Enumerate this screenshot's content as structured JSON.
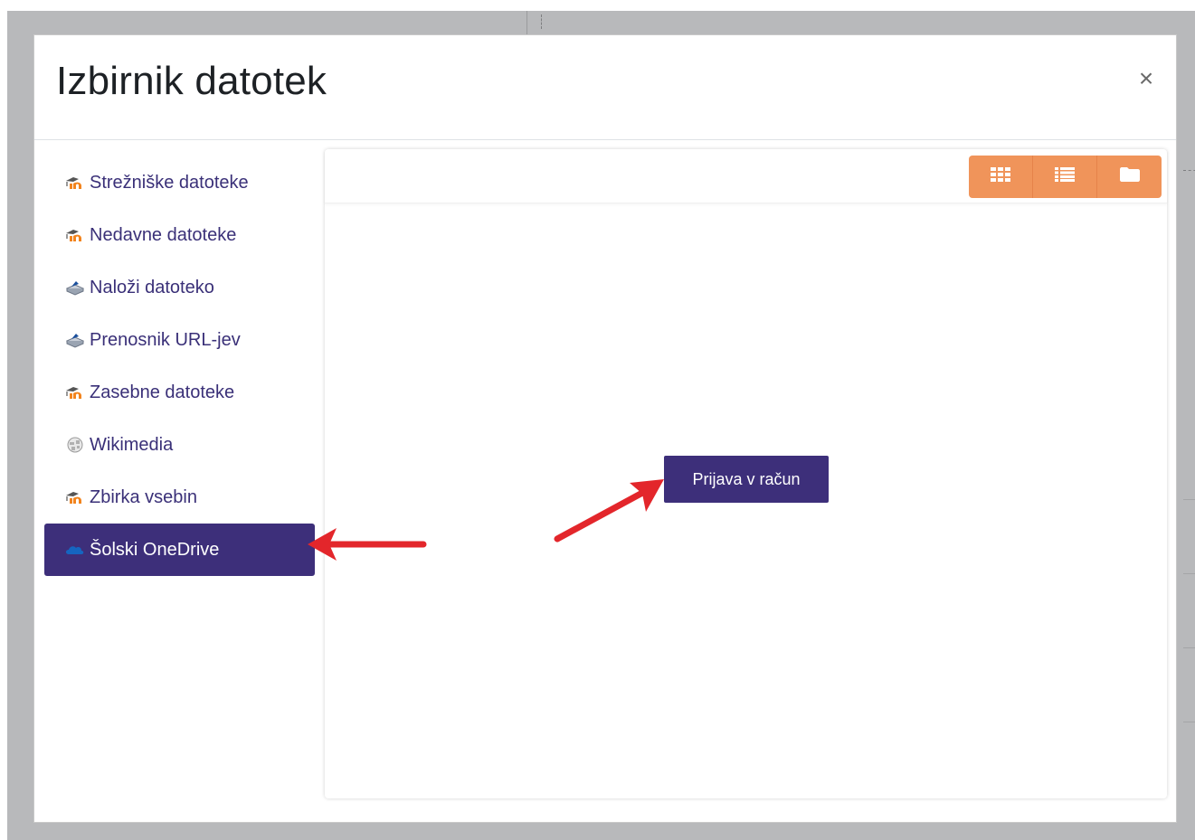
{
  "dialog": {
    "title": "Izbirnik datotek",
    "close_symbol": "×"
  },
  "sidebar": {
    "items": [
      {
        "label": "Strežniške datoteke",
        "icon": "moodle-icon",
        "active": false
      },
      {
        "label": "Nedavne datoteke",
        "icon": "moodle-icon",
        "active": false
      },
      {
        "label": "Naloži datoteko",
        "icon": "upload-icon",
        "active": false
      },
      {
        "label": "Prenosnik URL-jev",
        "icon": "upload-icon",
        "active": false
      },
      {
        "label": "Zasebne datoteke",
        "icon": "moodle-icon",
        "active": false
      },
      {
        "label": "Wikimedia",
        "icon": "wikimedia-globe-icon",
        "active": false
      },
      {
        "label": "Zbirka vsebin",
        "icon": "moodle-icon",
        "active": false
      },
      {
        "label": "Šolski OneDrive",
        "icon": "onedrive-cloud-icon",
        "active": true
      }
    ]
  },
  "toolbar": {
    "view_buttons": [
      "grid-view-icon",
      "list-view-icon",
      "folder-view-icon"
    ]
  },
  "main": {
    "login_button_label": "Prijava v račun"
  },
  "colors": {
    "accent": "#3d2f7a",
    "view_buttons": "#f0945a",
    "annotation_arrow": "#e3262b"
  }
}
